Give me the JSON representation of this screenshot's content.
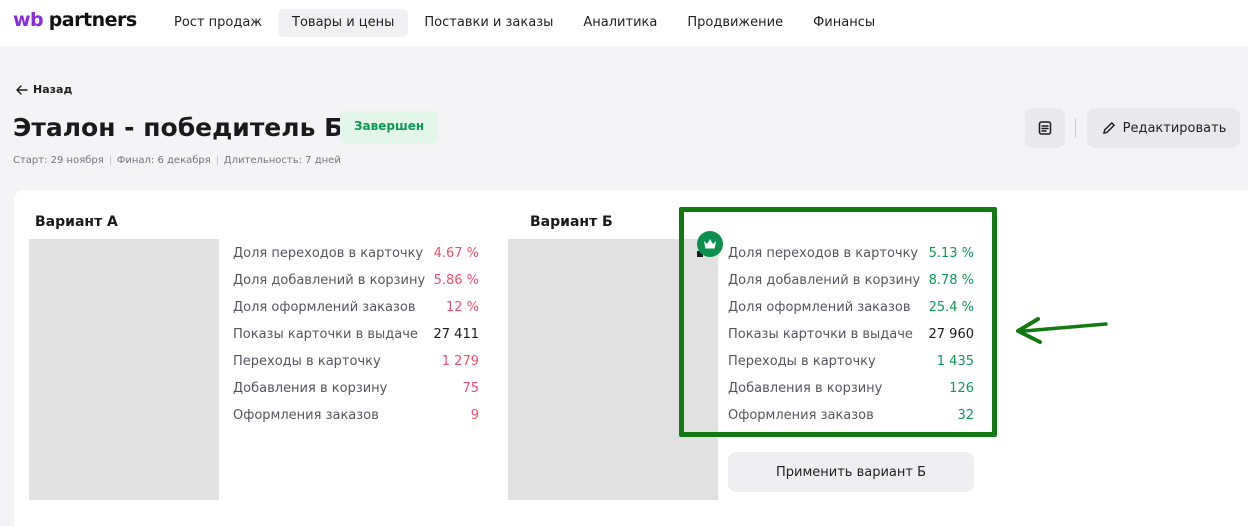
{
  "logo": {
    "wb": "wb",
    "partners": "partners"
  },
  "nav": [
    {
      "label": "Рост продаж",
      "active": false
    },
    {
      "label": "Товары и цены",
      "active": true
    },
    {
      "label": "Поставки и заказы",
      "active": false
    },
    {
      "label": "Аналитика",
      "active": false
    },
    {
      "label": "Продвижение",
      "active": false
    },
    {
      "label": "Финансы",
      "active": false
    }
  ],
  "header": {
    "back_label": "Назад",
    "title": "Эталон - победитель Б",
    "status": "Завершен",
    "meta": {
      "start": "Старт: 29 ноября",
      "finish": "Финал: 6 декабря",
      "duration": "Длительность: 7 дней"
    },
    "edit_label": "Редактировать"
  },
  "variant_a": {
    "label": "Вариант А",
    "metrics": [
      {
        "label": "Доля переходов в карточку",
        "value": "4.67 %",
        "tone": "red"
      },
      {
        "label": "Доля добавлений в корзину",
        "value": "5.86 %",
        "tone": "red"
      },
      {
        "label": "Доля оформлений заказов",
        "value": "12 %",
        "tone": "red"
      },
      {
        "label": "Показы карточки в выдаче",
        "value": "27 411",
        "tone": "dark"
      },
      {
        "label": "Переходы в карточку",
        "value": "1 279",
        "tone": "red"
      },
      {
        "label": "Добавления в корзину",
        "value": "75",
        "tone": "red"
      },
      {
        "label": "Оформления заказов",
        "value": "9",
        "tone": "red"
      }
    ]
  },
  "variant_b": {
    "label": "Вариант Б",
    "metrics": [
      {
        "label": "Доля переходов в карточку",
        "value": "5.13 %",
        "tone": "green"
      },
      {
        "label": "Доля добавлений в корзину",
        "value": "8.78 %",
        "tone": "green"
      },
      {
        "label": "Доля оформлений заказов",
        "value": "25.4 %",
        "tone": "green"
      },
      {
        "label": "Показы карточки в выдаче",
        "value": "27 960",
        "tone": "dark"
      },
      {
        "label": "Переходы в карточку",
        "value": "1 435",
        "tone": "green"
      },
      {
        "label": "Добавления в корзину",
        "value": "126",
        "tone": "green"
      },
      {
        "label": "Оформления заказов",
        "value": "32",
        "tone": "green"
      }
    ],
    "apply_label": "Применить вариант Б"
  },
  "colors": {
    "brand": "#8a2be2",
    "status_bg": "#e3f6ea",
    "status_text": "#0d9b55",
    "negative": "#f0506e",
    "positive": "#0d9b55",
    "annotation": "#137a13"
  },
  "icons": {
    "back": "arrow-left-icon",
    "notes": "notes-icon",
    "edit": "pencil-icon",
    "winner": "crown-icon",
    "annotation": "annotation-arrow-icon"
  }
}
